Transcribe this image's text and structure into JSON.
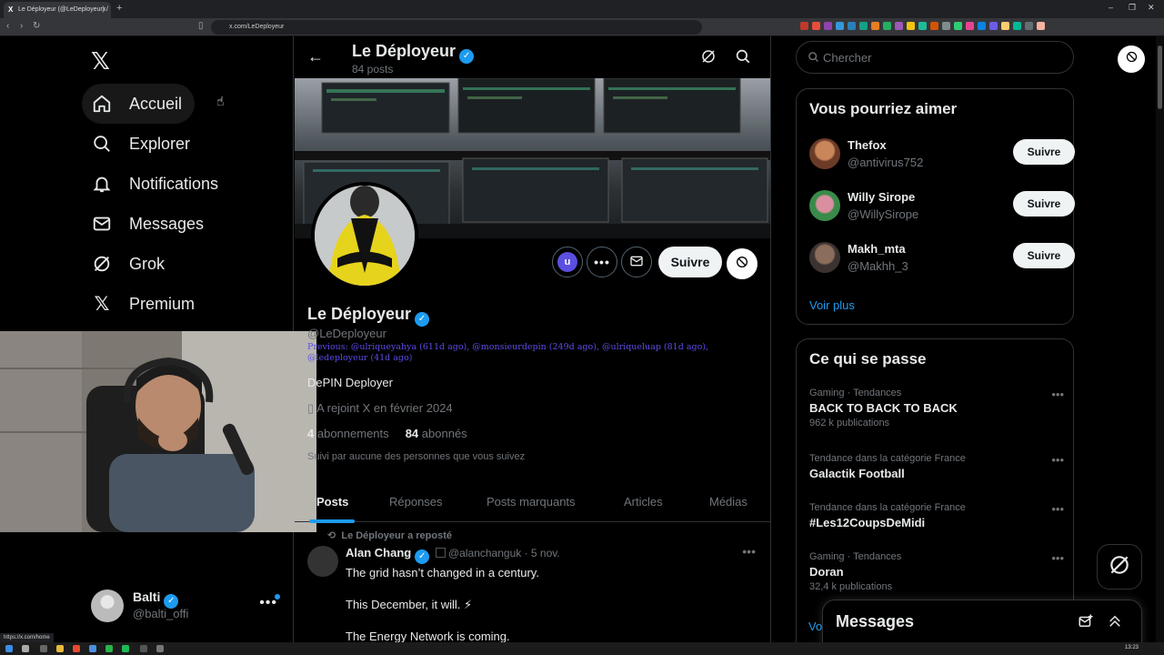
{
  "browser": {
    "tab_title": "Le Déployeur (@LeDeployeur) /",
    "url": "x.com/LeDeployeur",
    "status_url": "https://x.com/home",
    "clock": "13:23"
  },
  "nav": {
    "items": [
      {
        "label": "Accueil",
        "icon": "home-icon"
      },
      {
        "label": "Explorer",
        "icon": "search-icon"
      },
      {
        "label": "Notifications",
        "icon": "bell-icon"
      },
      {
        "label": "Messages",
        "icon": "mail-icon"
      },
      {
        "label": "Grok",
        "icon": "grok-icon"
      },
      {
        "label": "Premium",
        "icon": "x-icon"
      }
    ],
    "account": {
      "name": "Balti",
      "handle": "@balti_offi"
    }
  },
  "header": {
    "name": "Le Déployeur",
    "posts": "84 posts"
  },
  "profile": {
    "name": "Le Déployeur",
    "handle": "@LeDeployeur",
    "previous": "Previous: @ulriqueyahya (611d ago), @monsieurdepin (249d ago), @ulriqueluap (81d ago), @ledeployeur (41d ago)",
    "bio": "DePIN Deployer",
    "joined": "A rejoint X en février 2024",
    "following_count": "4",
    "following_label": "abonnements",
    "followers_count": "84",
    "followers_label": "abonnés",
    "not_followed": "Suivi par aucune des personnes que vous suivez",
    "follow_label": "Suivre",
    "u_badge": "u"
  },
  "tabs": [
    "Posts",
    "Réponses",
    "Posts marquants",
    "Articles",
    "Médias"
  ],
  "tweet": {
    "repost_label": "Le Déployeur a reposté",
    "author": "Alan Chang",
    "handle": "@alanchanguk · 5 nov.",
    "lines": [
      "The grid hasn’t changed in a century.",
      "This December, it will. ⚡",
      "The Energy Network is coming."
    ]
  },
  "right": {
    "search_placeholder": "Chercher",
    "who_title": "Vous pourriez aimer",
    "suggestions": [
      {
        "name": "Thefox",
        "handle": "@antivirus752",
        "button": "Suivre"
      },
      {
        "name": "Willy Sirope",
        "handle": "@WillySirope",
        "button": "Suivre"
      },
      {
        "name": "Makh_mta",
        "handle": "@Makhh_3",
        "button": "Suivre"
      }
    ],
    "voir_plus": "Voir plus",
    "trends_title": "Ce qui se passe",
    "trends": [
      {
        "context": "Gaming · Tendances",
        "title": "BACK TO BACK TO BACK",
        "count": "962 k publications"
      },
      {
        "context": "Tendance dans la catégorie France",
        "title": "Galactik Football",
        "count": ""
      },
      {
        "context": "Tendance dans la catégorie France",
        "title": "#Les12CoupsDeMidi",
        "count": ""
      },
      {
        "context": "Gaming · Tendances",
        "title": "Doran",
        "count": "32,4 k publications"
      }
    ],
    "voir_bottom": "Vo",
    "messages_title": "Messages"
  }
}
